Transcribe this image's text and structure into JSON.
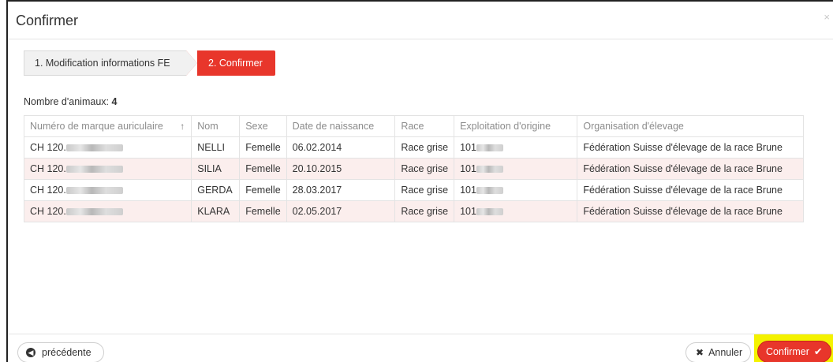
{
  "dialog": {
    "title": "Confirmer",
    "close_icon": "×"
  },
  "steps": [
    {
      "label": "1. Modification informations FE",
      "active": false
    },
    {
      "label": "2. Confirmer",
      "active": true
    }
  ],
  "animal_count": {
    "label": "Nombre d'animaux:",
    "value": "4"
  },
  "table": {
    "columns": [
      "Numéro de marque auriculaire",
      "Nom",
      "Sexe",
      "Date de naissance",
      "Race",
      "Exploitation d'origine",
      "Organisation d'élevage"
    ],
    "sort_icon": "↑",
    "rows": [
      {
        "ear_tag": "CH 120.",
        "name": "NELLI",
        "sex": "Femelle",
        "birth": "06.02.2014",
        "breed": "Race grise",
        "origin": "101",
        "org": "Fédération Suisse d'élevage de la race Brune"
      },
      {
        "ear_tag": "CH 120.",
        "name": "SILIA",
        "sex": "Femelle",
        "birth": "20.10.2015",
        "breed": "Race grise",
        "origin": "101",
        "org": "Fédération Suisse d'élevage de la race Brune"
      },
      {
        "ear_tag": "CH 120.",
        "name": "GERDA",
        "sex": "Femelle",
        "birth": "28.03.2017",
        "breed": "Race grise",
        "origin": "101",
        "org": "Fédération Suisse d'élevage de la race Brune"
      },
      {
        "ear_tag": "CH 120.",
        "name": "KLARA",
        "sex": "Femelle",
        "birth": "02.05.2017",
        "breed": "Race grise",
        "origin": "101",
        "org": "Fédération Suisse d'élevage de la race Brune"
      }
    ]
  },
  "footer": {
    "prev_label": "précédente",
    "cancel_label": "Annuler",
    "confirm_label": "Confirmer"
  },
  "colors": {
    "accent": "#e8362b",
    "row_highlight": "#fbeeed",
    "focus_highlight": "#f4f200"
  }
}
